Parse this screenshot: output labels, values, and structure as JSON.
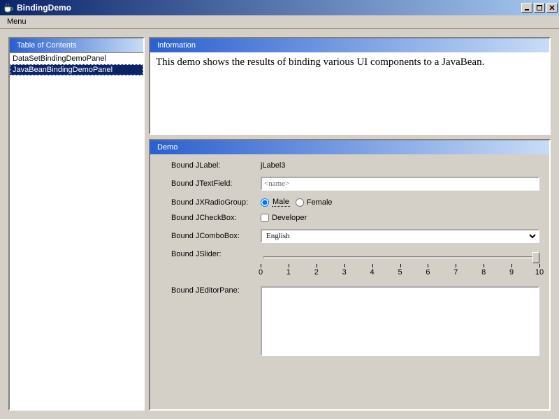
{
  "window": {
    "title": "BindingDemo"
  },
  "menubar": {
    "menu_label": "Menu"
  },
  "toc": {
    "header": "Table of Contents",
    "items": [
      "DataSetBindingDemoPanel",
      "JavaBeanBindingDemoPanel"
    ],
    "selected_index": 1
  },
  "info": {
    "header": "Information",
    "text": "This demo shows the results of binding various UI components to a JavaBean."
  },
  "demo": {
    "header": "Demo",
    "labels": {
      "jlabel": "Bound JLabel:",
      "jtextfield": "Bound JTextField:",
      "jxradiogroup": "Bound JXRadioGroup:",
      "jcheckbox": "Bound JCheckBox:",
      "jcombobox": "Bound JComboBox:",
      "jslider": "Bound JSlider:",
      "jeditorpane": "Bound JEditorPane:"
    },
    "jlabel_value": "jLabel3",
    "jtextfield_value": "<name>",
    "radio": {
      "options": [
        "Male",
        "Female"
      ],
      "selected": "Male"
    },
    "checkbox": {
      "label": "Developer",
      "checked": false
    },
    "combobox": {
      "value": "English"
    },
    "slider": {
      "min": 0,
      "max": 10,
      "value": 10
    },
    "editor_value": ""
  }
}
